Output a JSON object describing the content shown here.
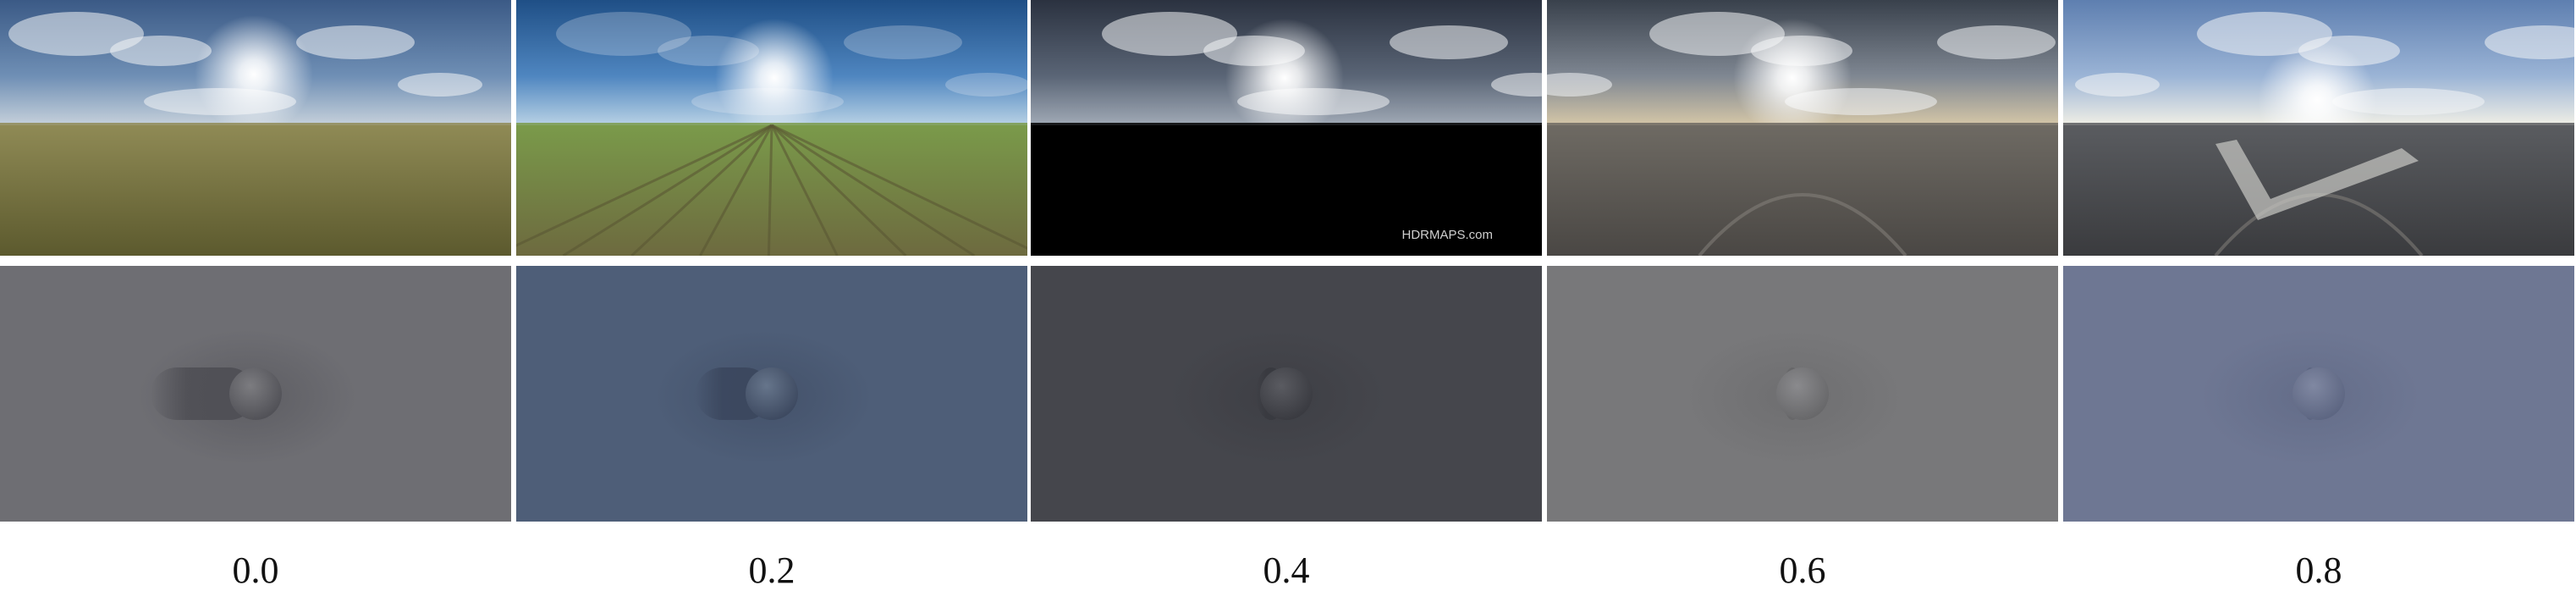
{
  "figure": {
    "columns": [
      {
        "label": "0.0",
        "environment": {
          "scene": "grassland-under-cloudy-sky",
          "sky_top": "#3b5a86",
          "sky_mid": "#6f8fb5",
          "sky_horizon": "#c9d3dc",
          "ground_near": "#5c5a2e",
          "ground_far": "#8f8a55",
          "sun_visible": true,
          "watermark": ""
        },
        "render": {
          "background": "#6e6e73",
          "sphere": "#7c7c80",
          "shadow": "#4f4f55",
          "shadow_length": 0.62
        }
      },
      {
        "label": "0.2",
        "environment": {
          "scene": "crop-field-under-clear-sky",
          "sky_top": "#1f4f86",
          "sky_mid": "#4f86c0",
          "sky_horizon": "#bcd4e6",
          "ground_near": "#6d6a3f",
          "ground_far": "#7a9a4a",
          "sun_visible": true,
          "watermark": ""
        },
        "render": {
          "background": "#4e5e78",
          "sphere": "#66758b",
          "shadow": "#3b475e",
          "shadow_length": 0.45
        }
      },
      {
        "label": "0.4",
        "environment": {
          "scene": "cloudy-sky-upper-hemisphere-only",
          "sky_top": "#2b3240",
          "sky_mid": "#5a6576",
          "sky_horizon": "#a3acb8",
          "ground_near": "#000000",
          "ground_far": "#000000",
          "sun_visible": true,
          "watermark": "HDRMAPS.com"
        },
        "render": {
          "background": "#45464c",
          "sphere": "#5a5b61",
          "shadow": "#38393f",
          "shadow_length": 0.18
        }
      },
      {
        "label": "0.6",
        "environment": {
          "scene": "road-under-stormy-clouds",
          "sky_top": "#39414c",
          "sky_mid": "#7f8792",
          "sky_horizon": "#d8c9a8",
          "ground_near": "#4a4744",
          "ground_far": "#6e6a63",
          "sun_visible": true,
          "watermark": ""
        },
        "render": {
          "background": "#78787a",
          "sphere": "#8a8a8d",
          "shadow": "#666668",
          "shadow_length": 0.12
        }
      },
      {
        "label": "0.8",
        "environment": {
          "scene": "paved-area-with-low-sun",
          "sky_top": "#5e7fb0",
          "sky_mid": "#9bb4d6",
          "sky_horizon": "#f3f1e6",
          "ground_near": "#3a3b3e",
          "ground_far": "#5a5c60",
          "sun_visible": true,
          "watermark": ""
        },
        "render": {
          "background": "#6e7793",
          "sphere": "#8088a2",
          "shadow": "#5b6480",
          "shadow_length": 0.1
        }
      }
    ]
  }
}
